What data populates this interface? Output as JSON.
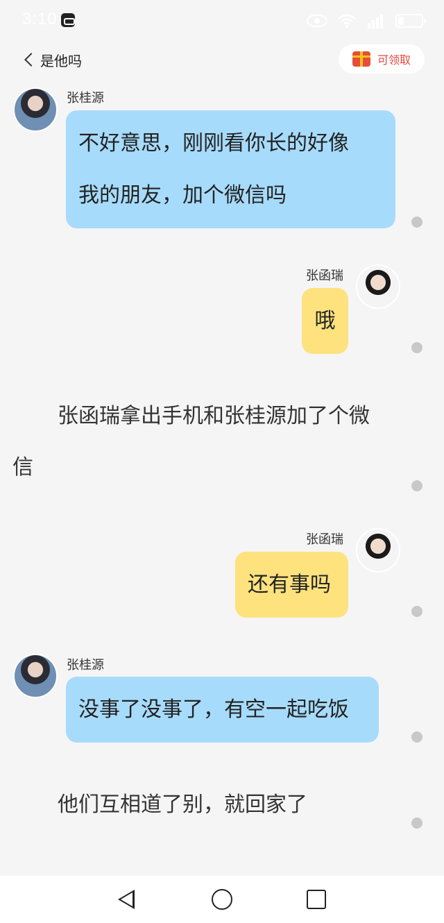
{
  "status_bar": {
    "time": "3:10"
  },
  "header": {
    "back_label": "是他吗",
    "claim_label": "可领取"
  },
  "messages": [
    {
      "speaker": "张桂源",
      "lines": [
        "不好意思，刚刚看你长的好像",
        "我的朋友，加个微信吗"
      ]
    },
    {
      "speaker": "张函瑞",
      "lines": [
        "哦"
      ]
    },
    {
      "narration": [
        "张函瑞拿出手机和张桂源加了个微",
        "信"
      ]
    },
    {
      "speaker": "张函瑞",
      "lines": [
        "还有事吗"
      ]
    },
    {
      "speaker": "张桂源",
      "lines": [
        "没事了没事了，有空一起吃饭"
      ]
    },
    {
      "narration": [
        "他们互相道了别，就回家了"
      ]
    }
  ],
  "colors": {
    "left_bubble": "#a7dbfb",
    "right_bubble": "#fde27e",
    "background": "#f5f5f5"
  }
}
